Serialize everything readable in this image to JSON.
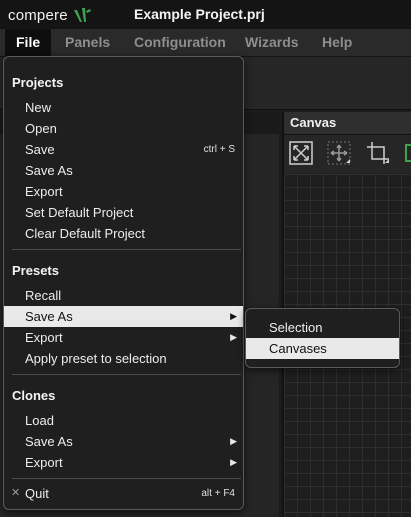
{
  "app": {
    "logo_text": "compere",
    "window_title": "Example Project.prj"
  },
  "menubar": {
    "items": [
      {
        "label": "File",
        "active": true
      },
      {
        "label": "Panels"
      },
      {
        "label": "Configuration"
      },
      {
        "label": "Wizards"
      },
      {
        "label": "Help"
      }
    ]
  },
  "canvas_panel": {
    "title": "Canvas",
    "tools": [
      "fit-view-icon",
      "move-icon",
      "crop-icon"
    ]
  },
  "file_menu": {
    "projects": {
      "title": "Projects",
      "items": [
        {
          "label": "New"
        },
        {
          "label": "Open"
        },
        {
          "label": "Save",
          "shortcut": "ctrl + S"
        },
        {
          "label": "Save As"
        },
        {
          "label": "Export"
        },
        {
          "label": "Set Default Project"
        },
        {
          "label": "Clear Default Project"
        }
      ]
    },
    "presets": {
      "title": "Presets",
      "items": [
        {
          "label": "Recall"
        },
        {
          "label": "Save As",
          "submenu": true,
          "highlighted": true
        },
        {
          "label": "Export",
          "submenu": true
        },
        {
          "label": "Apply preset to selection"
        }
      ]
    },
    "clones": {
      "title": "Clones",
      "items": [
        {
          "label": "Load"
        },
        {
          "label": "Save As",
          "submenu": true
        },
        {
          "label": "Export",
          "submenu": true
        }
      ]
    },
    "quit": {
      "label": "Quit",
      "shortcut": "alt + F4",
      "icon": "close-icon"
    }
  },
  "submenu": {
    "items": [
      {
        "label": "Selection"
      },
      {
        "label": "Canvases",
        "highlighted": true
      }
    ]
  },
  "colors": {
    "highlight_bg": "#e9e9e9",
    "menu_bg": "#1f1f1f",
    "accent_green": "#3fa34d"
  }
}
